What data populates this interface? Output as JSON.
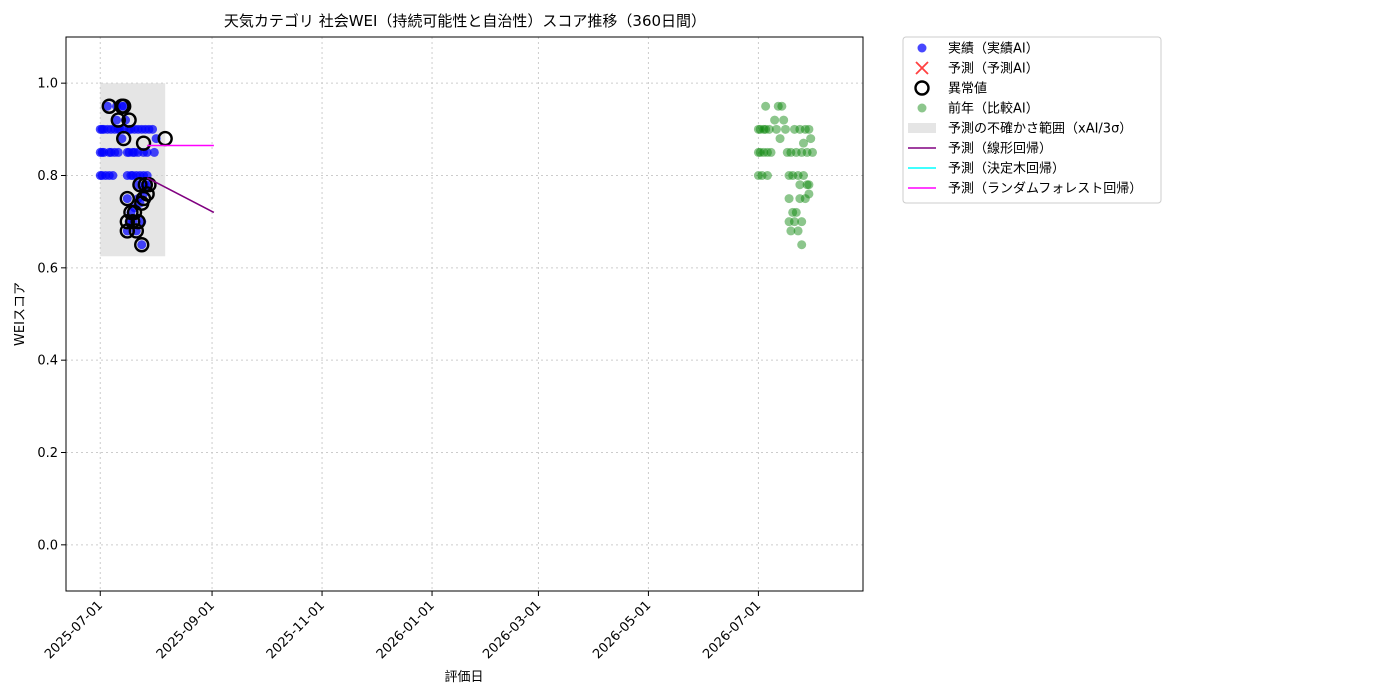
{
  "chart_data": {
    "type": "scatter",
    "title": "天気カテゴリ 社会WEI（持続可能性と自治性）スコア推移（360日間）",
    "xlabel": "評価日",
    "ylabel": "WEIスコア",
    "xlim": [
      "2025-06-12",
      "2026-08-28"
    ],
    "ylim": [
      -0.1,
      1.1
    ],
    "grid": true,
    "legend_position": "outside-top-right",
    "x_ticks": [
      "2025-07-01",
      "2025-09-01",
      "2025-11-01",
      "2026-01-01",
      "2026-03-01",
      "2026-05-01",
      "2026-07-01"
    ],
    "y_ticks": [
      "0.0",
      "0.2",
      "0.4",
      "0.6",
      "0.8",
      "1.0"
    ],
    "legend": [
      {
        "label": "実績（実績AI）",
        "marker": "dot",
        "color": "#0000ff"
      },
      {
        "label": "予測（予測AI）",
        "marker": "x",
        "color": "#ff0000"
      },
      {
        "label": "異常値",
        "marker": "ring",
        "color": "#000000"
      },
      {
        "label": "前年（比較AI）",
        "marker": "dot",
        "color": "#008000"
      },
      {
        "label": "予測の不確かさ範囲（xAI/3σ）",
        "marker": "band",
        "color": "#d3d3d3"
      },
      {
        "label": "予測（線形回帰）",
        "marker": "line",
        "color": "#800080"
      },
      {
        "label": "予測（決定木回帰）",
        "marker": "line",
        "color": "#00ffff"
      },
      {
        "label": "予測（ランダムフォレスト回帰）",
        "marker": "line",
        "color": "#ff00ff"
      }
    ],
    "uncertainty_band": {
      "x_start": "2025-07-01",
      "x_end": "2025-08-06",
      "y_low": 0.625,
      "y_high": 1.0
    },
    "series": [
      {
        "name": "実績（実績AI）",
        "color": "#0000ff",
        "points": [
          [
            "2025-07-01",
            0.9
          ],
          [
            "2025-07-01",
            0.85
          ],
          [
            "2025-07-01",
            0.8
          ],
          [
            "2025-07-02",
            0.9
          ],
          [
            "2025-07-02",
            0.85
          ],
          [
            "2025-07-02",
            0.8
          ],
          [
            "2025-07-03",
            0.9
          ],
          [
            "2025-07-03",
            0.85
          ],
          [
            "2025-07-04",
            0.8
          ],
          [
            "2025-07-05",
            0.95
          ],
          [
            "2025-07-05",
            0.9
          ],
          [
            "2025-07-06",
            0.85
          ],
          [
            "2025-07-06",
            0.8
          ],
          [
            "2025-07-07",
            0.9
          ],
          [
            "2025-07-07",
            0.85
          ],
          [
            "2025-07-08",
            0.8
          ],
          [
            "2025-07-09",
            0.9
          ],
          [
            "2025-07-09",
            0.85
          ],
          [
            "2025-07-10",
            0.95
          ],
          [
            "2025-07-10",
            0.92
          ],
          [
            "2025-07-11",
            0.9
          ],
          [
            "2025-07-11",
            0.85
          ],
          [
            "2025-07-12",
            0.9
          ],
          [
            "2025-07-13",
            0.88
          ],
          [
            "2025-07-13",
            0.95
          ],
          [
            "2025-07-14",
            0.9
          ],
          [
            "2025-07-14",
            0.95
          ],
          [
            "2025-07-15",
            0.92
          ],
          [
            "2025-07-16",
            0.85
          ],
          [
            "2025-07-16",
            0.8
          ],
          [
            "2025-07-17",
            0.9
          ],
          [
            "2025-07-17",
            0.85
          ],
          [
            "2025-07-18",
            0.8
          ],
          [
            "2025-07-18",
            0.9
          ],
          [
            "2025-07-19",
            0.85
          ],
          [
            "2025-07-19",
            0.8
          ],
          [
            "2025-07-20",
            0.9
          ],
          [
            "2025-07-20",
            0.85
          ],
          [
            "2025-07-21",
            0.8
          ],
          [
            "2025-07-22",
            0.9
          ],
          [
            "2025-07-22",
            0.85
          ],
          [
            "2025-07-23",
            0.8
          ],
          [
            "2025-07-24",
            0.9
          ],
          [
            "2025-07-25",
            0.85
          ],
          [
            "2025-07-25",
            0.8
          ],
          [
            "2025-07-26",
            0.9
          ],
          [
            "2025-07-27",
            0.85
          ],
          [
            "2025-07-27",
            0.8
          ],
          [
            "2025-07-28",
            0.9
          ],
          [
            "2025-07-30",
            0.9
          ],
          [
            "2025-07-31",
            0.85
          ],
          [
            "2025-08-01",
            0.88
          ],
          [
            "2025-07-16",
            0.75
          ],
          [
            "2025-07-16",
            0.68
          ],
          [
            "2025-07-17",
            0.7
          ],
          [
            "2025-07-18",
            0.72
          ],
          [
            "2025-07-19",
            0.7
          ],
          [
            "2025-07-20",
            0.73
          ],
          [
            "2025-07-21",
            0.68
          ],
          [
            "2025-07-22",
            0.78
          ],
          [
            "2025-07-22",
            0.75
          ],
          [
            "2025-07-23",
            0.74
          ],
          [
            "2025-07-24",
            0.7
          ],
          [
            "2025-07-24",
            0.65
          ],
          [
            "2025-07-25",
            0.77
          ],
          [
            "2025-07-25",
            0.76
          ],
          [
            "2025-07-26",
            0.78
          ],
          [
            "2025-07-27",
            0.78
          ]
        ]
      },
      {
        "name": "異常値",
        "color": "#000000",
        "points": [
          [
            "2025-07-06",
            0.95
          ],
          [
            "2025-07-11",
            0.92
          ],
          [
            "2025-07-13",
            0.95
          ],
          [
            "2025-07-14",
            0.95
          ],
          [
            "2025-07-14",
            0.88
          ],
          [
            "2025-07-17",
            0.92
          ],
          [
            "2025-07-16",
            0.75
          ],
          [
            "2025-07-16",
            0.7
          ],
          [
            "2025-07-16",
            0.68
          ],
          [
            "2025-07-18",
            0.72
          ],
          [
            "2025-07-19",
            0.7
          ],
          [
            "2025-07-20",
            0.72
          ],
          [
            "2025-07-21",
            0.68
          ],
          [
            "2025-07-22",
            0.7
          ],
          [
            "2025-07-23",
            0.78
          ],
          [
            "2025-07-24",
            0.74
          ],
          [
            "2025-07-24",
            0.65
          ],
          [
            "2025-07-25",
            0.87
          ],
          [
            "2025-07-25",
            0.75
          ],
          [
            "2025-07-26",
            0.78
          ],
          [
            "2025-07-27",
            0.76
          ],
          [
            "2025-07-28",
            0.78
          ],
          [
            "2025-08-06",
            0.88
          ]
        ]
      },
      {
        "name": "前年（比較AI）",
        "color": "#008000",
        "points": [
          [
            "2026-07-01",
            0.9
          ],
          [
            "2026-07-01",
            0.85
          ],
          [
            "2026-07-01",
            0.8
          ],
          [
            "2026-07-02",
            0.9
          ],
          [
            "2026-07-02",
            0.85
          ],
          [
            "2026-07-03",
            0.8
          ],
          [
            "2026-07-04",
            0.9
          ],
          [
            "2026-07-04",
            0.85
          ],
          [
            "2026-07-05",
            0.95
          ],
          [
            "2026-07-05",
            0.9
          ],
          [
            "2026-07-06",
            0.85
          ],
          [
            "2026-07-06",
            0.8
          ],
          [
            "2026-07-07",
            0.9
          ],
          [
            "2026-07-08",
            0.85
          ],
          [
            "2026-07-10",
            0.92
          ],
          [
            "2026-07-11",
            0.9
          ],
          [
            "2026-07-12",
            0.95
          ],
          [
            "2026-07-13",
            0.88
          ],
          [
            "2026-07-14",
            0.95
          ],
          [
            "2026-07-15",
            0.92
          ],
          [
            "2026-07-16",
            0.9
          ],
          [
            "2026-07-17",
            0.85
          ],
          [
            "2026-07-18",
            0.8
          ],
          [
            "2026-07-19",
            0.85
          ],
          [
            "2026-07-20",
            0.8
          ],
          [
            "2026-07-21",
            0.9
          ],
          [
            "2026-07-22",
            0.85
          ],
          [
            "2026-07-23",
            0.8
          ],
          [
            "2026-07-24",
            0.9
          ],
          [
            "2026-07-25",
            0.85
          ],
          [
            "2026-07-26",
            0.8
          ],
          [
            "2026-07-27",
            0.9
          ],
          [
            "2026-07-28",
            0.85
          ],
          [
            "2026-07-29",
            0.9
          ],
          [
            "2026-07-30",
            0.88
          ],
          [
            "2026-07-31",
            0.85
          ],
          [
            "2026-07-18",
            0.75
          ],
          [
            "2026-07-18",
            0.7
          ],
          [
            "2026-07-19",
            0.68
          ],
          [
            "2026-07-20",
            0.72
          ],
          [
            "2026-07-21",
            0.7
          ],
          [
            "2026-07-22",
            0.72
          ],
          [
            "2026-07-23",
            0.68
          ],
          [
            "2026-07-24",
            0.78
          ],
          [
            "2026-07-24",
            0.75
          ],
          [
            "2026-07-25",
            0.65
          ],
          [
            "2026-07-25",
            0.7
          ],
          [
            "2026-07-26",
            0.87
          ],
          [
            "2026-07-27",
            0.75
          ],
          [
            "2026-07-28",
            0.78
          ],
          [
            "2026-07-29",
            0.76
          ],
          [
            "2026-07-29",
            0.78
          ]
        ]
      }
    ],
    "prediction_lines": [
      {
        "name": "予測（線形回帰）",
        "color": "#800080",
        "points": [
          [
            "2025-07-27",
            0.795
          ],
          [
            "2025-09-02",
            0.72
          ]
        ]
      },
      {
        "name": "予測（ランダムフォレスト回帰）",
        "color": "#ff00ff",
        "points": [
          [
            "2025-07-27",
            0.865
          ],
          [
            "2025-09-02",
            0.865
          ]
        ]
      }
    ]
  }
}
